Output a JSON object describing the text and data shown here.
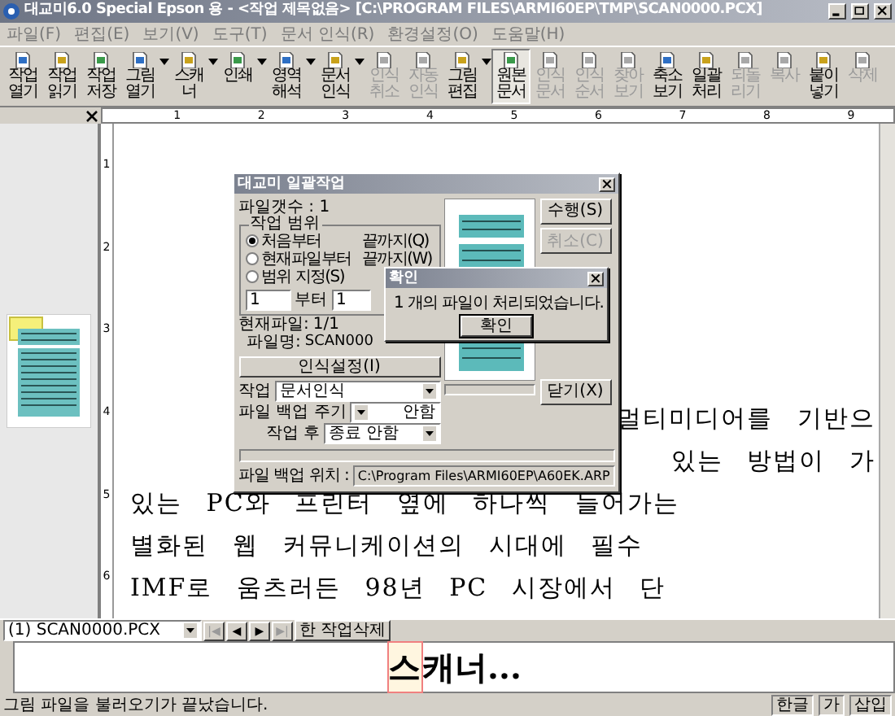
{
  "window": {
    "title": "대교미6.0 Special Epson 용 - <작업 제목없음> [C:\\PROGRAM FILES\\ARMI60EP\\TMP\\SCAN0000.PCX]"
  },
  "menu": [
    "파일(F)",
    "편집(E)",
    "보기(V)",
    "도구(T)",
    "문서 인식(R)",
    "환경설정(O)",
    "도움말(H)"
  ],
  "toolbar": [
    {
      "label": "작업열기",
      "disabled": false,
      "pressed": false,
      "dropdown": false
    },
    {
      "label": "작업읽기",
      "disabled": false,
      "pressed": false,
      "dropdown": false
    },
    {
      "label": "작업저장",
      "disabled": false,
      "pressed": false,
      "dropdown": false
    },
    {
      "label": "그림열기",
      "disabled": false,
      "pressed": false,
      "dropdown": true
    },
    {
      "label": "스캐너",
      "disabled": false,
      "pressed": false,
      "dropdown": true
    },
    {
      "label": "인쇄",
      "disabled": false,
      "pressed": false,
      "dropdown": true
    },
    {
      "label": "영역해석",
      "disabled": false,
      "pressed": false,
      "dropdown": true
    },
    {
      "label": "문서인식",
      "disabled": false,
      "pressed": false,
      "dropdown": true
    },
    {
      "label": "인식취소",
      "disabled": true,
      "pressed": false,
      "dropdown": false
    },
    {
      "label": "자동인식",
      "disabled": true,
      "pressed": false,
      "dropdown": false
    },
    {
      "label": "그림편집",
      "disabled": false,
      "pressed": false,
      "dropdown": true
    },
    {
      "label": "원본문서",
      "disabled": false,
      "pressed": true,
      "dropdown": false
    },
    {
      "label": "인식문서",
      "disabled": true,
      "pressed": false,
      "dropdown": false
    },
    {
      "label": "인식순서",
      "disabled": true,
      "pressed": false,
      "dropdown": false
    },
    {
      "label": "찾아보기",
      "disabled": true,
      "pressed": false,
      "dropdown": false
    },
    {
      "label": "축소보기",
      "disabled": false,
      "pressed": false,
      "dropdown": false
    },
    {
      "label": "일괄처리",
      "disabled": false,
      "pressed": false,
      "dropdown": false
    },
    {
      "label": "되돌리기",
      "disabled": true,
      "pressed": false,
      "dropdown": false
    },
    {
      "label": "복사",
      "disabled": true,
      "pressed": false,
      "dropdown": false
    },
    {
      "label": "붙이넣기",
      "disabled": false,
      "pressed": false,
      "dropdown": false
    },
    {
      "label": "삭제",
      "disabled": true,
      "pressed": false,
      "dropdown": false
    }
  ],
  "ruler": {
    "horizontal": [
      "1",
      "2",
      "3",
      "4",
      "5",
      "6",
      "7",
      "8",
      "9"
    ],
    "vertical": [
      "1",
      "2",
      "3",
      "4",
      "5",
      "6"
    ]
  },
  "document": {
    "lines": [
      {
        "kind": "partial",
        "text": "멀티미디어를 기반으"
      },
      {
        "kind": "partial",
        "text": "있는 방법이 가"
      },
      {
        "kind": "full",
        "text": "있는 PC와 프린터 옆에 하나씩 늘어가는"
      },
      {
        "kind": "full",
        "text": "별화된 웹 커뮤니케이션의 시대에 필수"
      },
      {
        "kind": "full",
        "text": "IMF로 움츠러든 98년 PC 시장에서 단"
      }
    ]
  },
  "dialog": {
    "title": "대교미 일괄작업",
    "file_count": "파일갯수 : 1",
    "range_group": "작업 범위",
    "ranges": [
      {
        "label": "처음부터",
        "selected": true,
        "end": "끝까지(Q)"
      },
      {
        "label": "현재파일부터",
        "selected": false,
        "end": "끝까지(W)"
      },
      {
        "label": "범위 지정(S)",
        "selected": false
      }
    ],
    "range_from": "1",
    "from_label": "부터",
    "range_to": "1",
    "current_label": "현재파일:",
    "current_value": "1/1",
    "file_name_label": "파일명:",
    "file_name": "SCAN000",
    "settings_button": "인식설정(I)",
    "job_label": "작업",
    "job_value": "문서인식",
    "backup_label": "파일 백업 주기",
    "backup_value": "안함",
    "after_label": "작업 후",
    "after_value": "종료 안함",
    "location_label": "파일 백업 위치 :",
    "location_value": "C:\\Program Files\\ARMI60EP\\A60EK.ARP",
    "buttons": [
      {
        "label": "수행(S)",
        "disabled": false
      },
      {
        "label": "취소(C)",
        "disabled": true
      },
      {
        "label": "닫기(X)",
        "disabled": false
      }
    ]
  },
  "message_box": {
    "title": "확인",
    "message": "1 개의 파일이 처리되었습니다.",
    "button": "확인"
  },
  "page_nav": {
    "file": "(1) SCAN0000.PCX",
    "buttons": [
      {
        "label": "|◀",
        "disabled": true
      },
      {
        "label": "◀",
        "disabled": false
      },
      {
        "label": "▶",
        "disabled": false
      },
      {
        "label": "▶|",
        "disabled": true
      }
    ],
    "delete_button": "한 작업삭제"
  },
  "recognition": {
    "highlight": "스",
    "rest": "캐너..."
  },
  "status_bar": {
    "message": "그림 파일을 불러오기가 끝났습니다.",
    "indicators": [
      "한글",
      "가",
      "삽입"
    ]
  }
}
